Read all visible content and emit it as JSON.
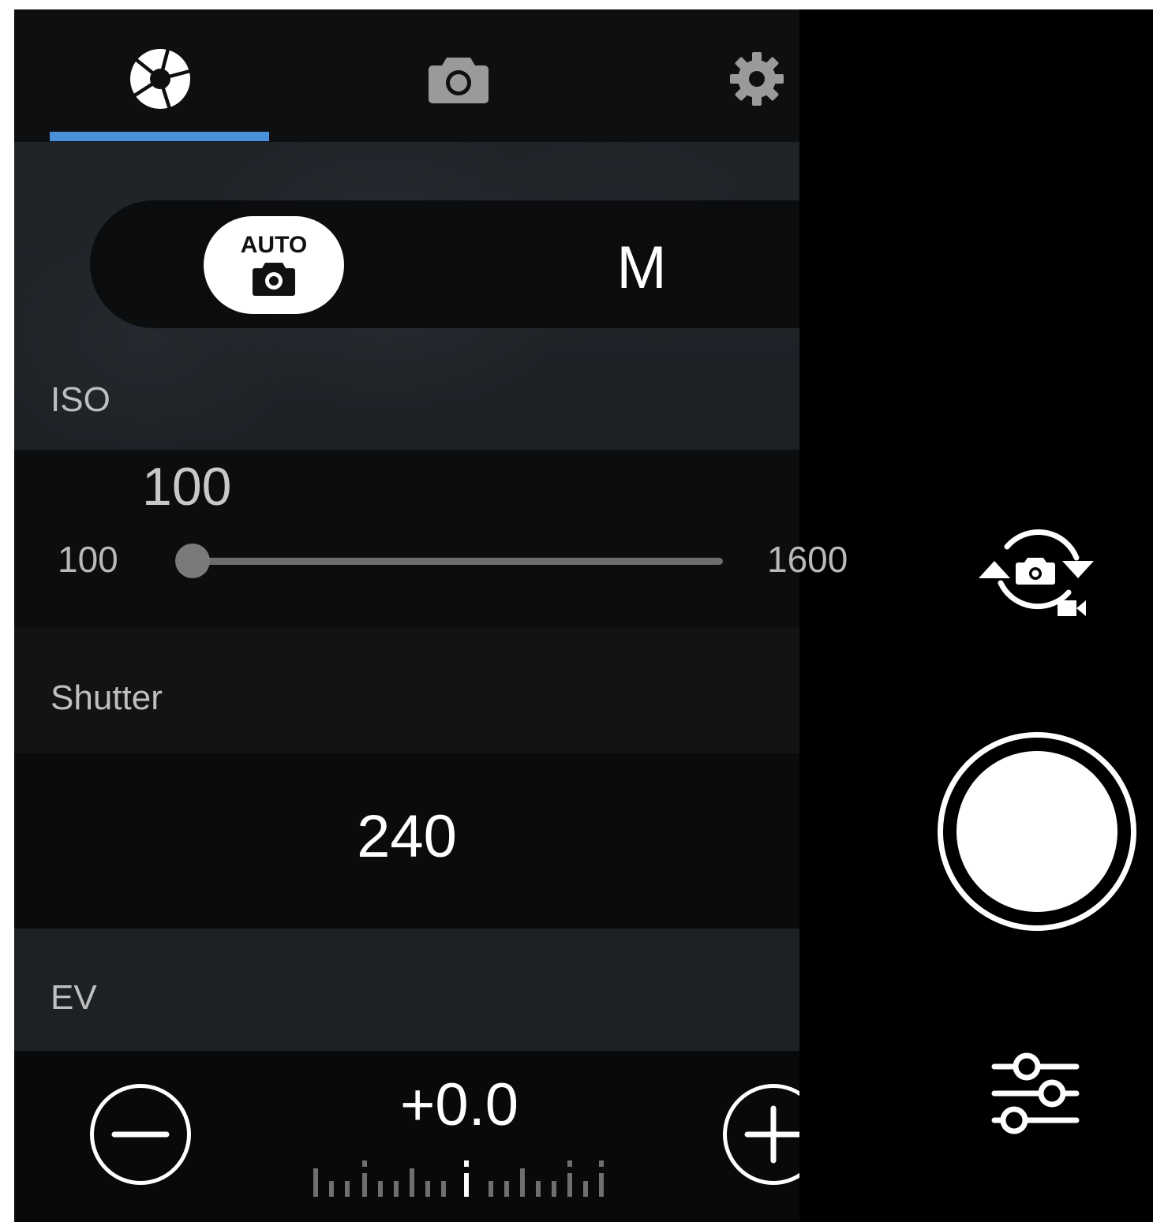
{
  "tabs": [
    {
      "name": "aperture-icon",
      "active": true
    },
    {
      "name": "camera-icon",
      "active": false
    },
    {
      "name": "gear-icon",
      "active": false
    }
  ],
  "accent_color": "#4a90d9",
  "mode": {
    "auto_label": "AUTO",
    "manual_label": "M",
    "selected": "AUTO"
  },
  "iso": {
    "label": "ISO",
    "value": "100",
    "min": "100",
    "max": "1600",
    "slider_fraction": 0.0
  },
  "shutter": {
    "label": "Shutter",
    "value": "240"
  },
  "ev": {
    "label": "EV",
    "value": "+0.0"
  },
  "controls": {
    "switch_camera_icon": "switch-camera-video-icon",
    "shutter_icon": "shutter-button",
    "settings_icon": "sliders-icon"
  }
}
